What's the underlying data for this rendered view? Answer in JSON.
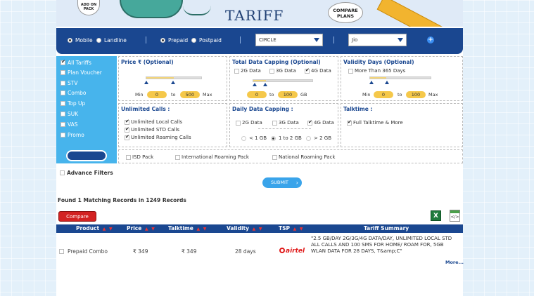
{
  "banner": {
    "title": "TARIFF",
    "addon_badge": "ADD ON PACK",
    "compare_badge": "COMPARE PLANS"
  },
  "filterbar": {
    "connection": [
      {
        "label": "Mobile",
        "selected": true
      },
      {
        "label": "Landline",
        "selected": false
      }
    ],
    "plan_type": [
      {
        "label": "Prepaid",
        "selected": true
      },
      {
        "label": "Postpaid",
        "selected": false
      }
    ],
    "circle_value": "CIRCLE",
    "operator_value": "Jio",
    "add_symbol": "+"
  },
  "categories": [
    {
      "label": "All Tariffs",
      "checked": true
    },
    {
      "label": "Plan Voucher",
      "checked": false
    },
    {
      "label": "STV",
      "checked": false
    },
    {
      "label": "Combo",
      "checked": false
    },
    {
      "label": "Top Up",
      "checked": false
    },
    {
      "label": "SUK",
      "checked": false
    },
    {
      "label": "VAS",
      "checked": false
    },
    {
      "label": "Promo",
      "checked": false
    }
  ],
  "price": {
    "title": "Price ₹ (Optional)",
    "min_label": "Min",
    "min_value": "0",
    "to_label": "to",
    "max_value": "500",
    "max_label": "Max"
  },
  "data_capping": {
    "title": "Total Data Capping (Optional)",
    "options": [
      {
        "label": "2G Data",
        "checked": false
      },
      {
        "label": "3G Data",
        "checked": false
      },
      {
        "label": "4G Data",
        "checked": true
      }
    ],
    "min_value": "0",
    "to_label": "to",
    "max_value": "100",
    "unit": "GB"
  },
  "validity": {
    "title": "Validity Days (Optional)",
    "more_label": "More Than 365 Days",
    "min_label": "Min",
    "min_value": "0",
    "to_label": "to",
    "max_value": "100",
    "max_label": "Max"
  },
  "unlimited_calls": {
    "title": "Unlimited Calls :",
    "options": [
      {
        "label": "Unlimited Local Calls",
        "checked": true
      },
      {
        "label": "Unlimited STD Calls",
        "checked": true
      },
      {
        "label": "Unlimited Roaming Calls",
        "checked": true
      }
    ]
  },
  "daily_data": {
    "title": "Daily Data Capping :",
    "types": [
      {
        "label": "2G Data",
        "checked": false
      },
      {
        "label": "3G Data",
        "checked": false
      },
      {
        "label": "4G Data",
        "checked": true
      }
    ],
    "amounts": [
      {
        "label": "< 1 GB",
        "selected": false
      },
      {
        "label": "1 to 2 GB",
        "selected": true
      },
      {
        "label": "> 2 GB",
        "selected": false
      }
    ]
  },
  "talktime": {
    "title": "Talktime :",
    "option": {
      "label": "Full Talktime & More",
      "checked": true
    }
  },
  "packs": [
    {
      "label": "ISD Pack"
    },
    {
      "label": "International Roaming Pack"
    },
    {
      "label": "National Roaming Pack"
    }
  ],
  "advanced_filters": "Advance Filters",
  "submit_label": "SUBMIT",
  "found_text": "Found 1 Matching Records in 1249 Records",
  "compare_label": "Compare",
  "excel_icon_text": "X",
  "code_icon_text": "</>",
  "table": {
    "sort_up": "▲",
    "sort_down": "▼",
    "headers": [
      "Product",
      "Price",
      "Talktime",
      "Validity",
      "TSP",
      "Tariff Summary"
    ],
    "rows": [
      {
        "product": "Prepaid Combo",
        "price": "₹ 349",
        "talktime": "₹ 349",
        "validity": "28 days",
        "tsp": "airtel",
        "summary": "\"2.5 GB/DAY 2G/3G/4G DATA/DAY, UNLIMITED LOCAL STD ALL CALLS AND 100 SMS FOR HOME/ ROAM FOR, 5GB WLAN DATA FOR 28 DAYS, T&amp;C\"",
        "more": "More..."
      }
    ]
  },
  "colors": {
    "brand_blue": "#1a4790",
    "panel_blue": "#47b4ec",
    "accent_yellow": "#f5c84a",
    "compare_red": "#d32222",
    "sort_red": "#e33333"
  }
}
